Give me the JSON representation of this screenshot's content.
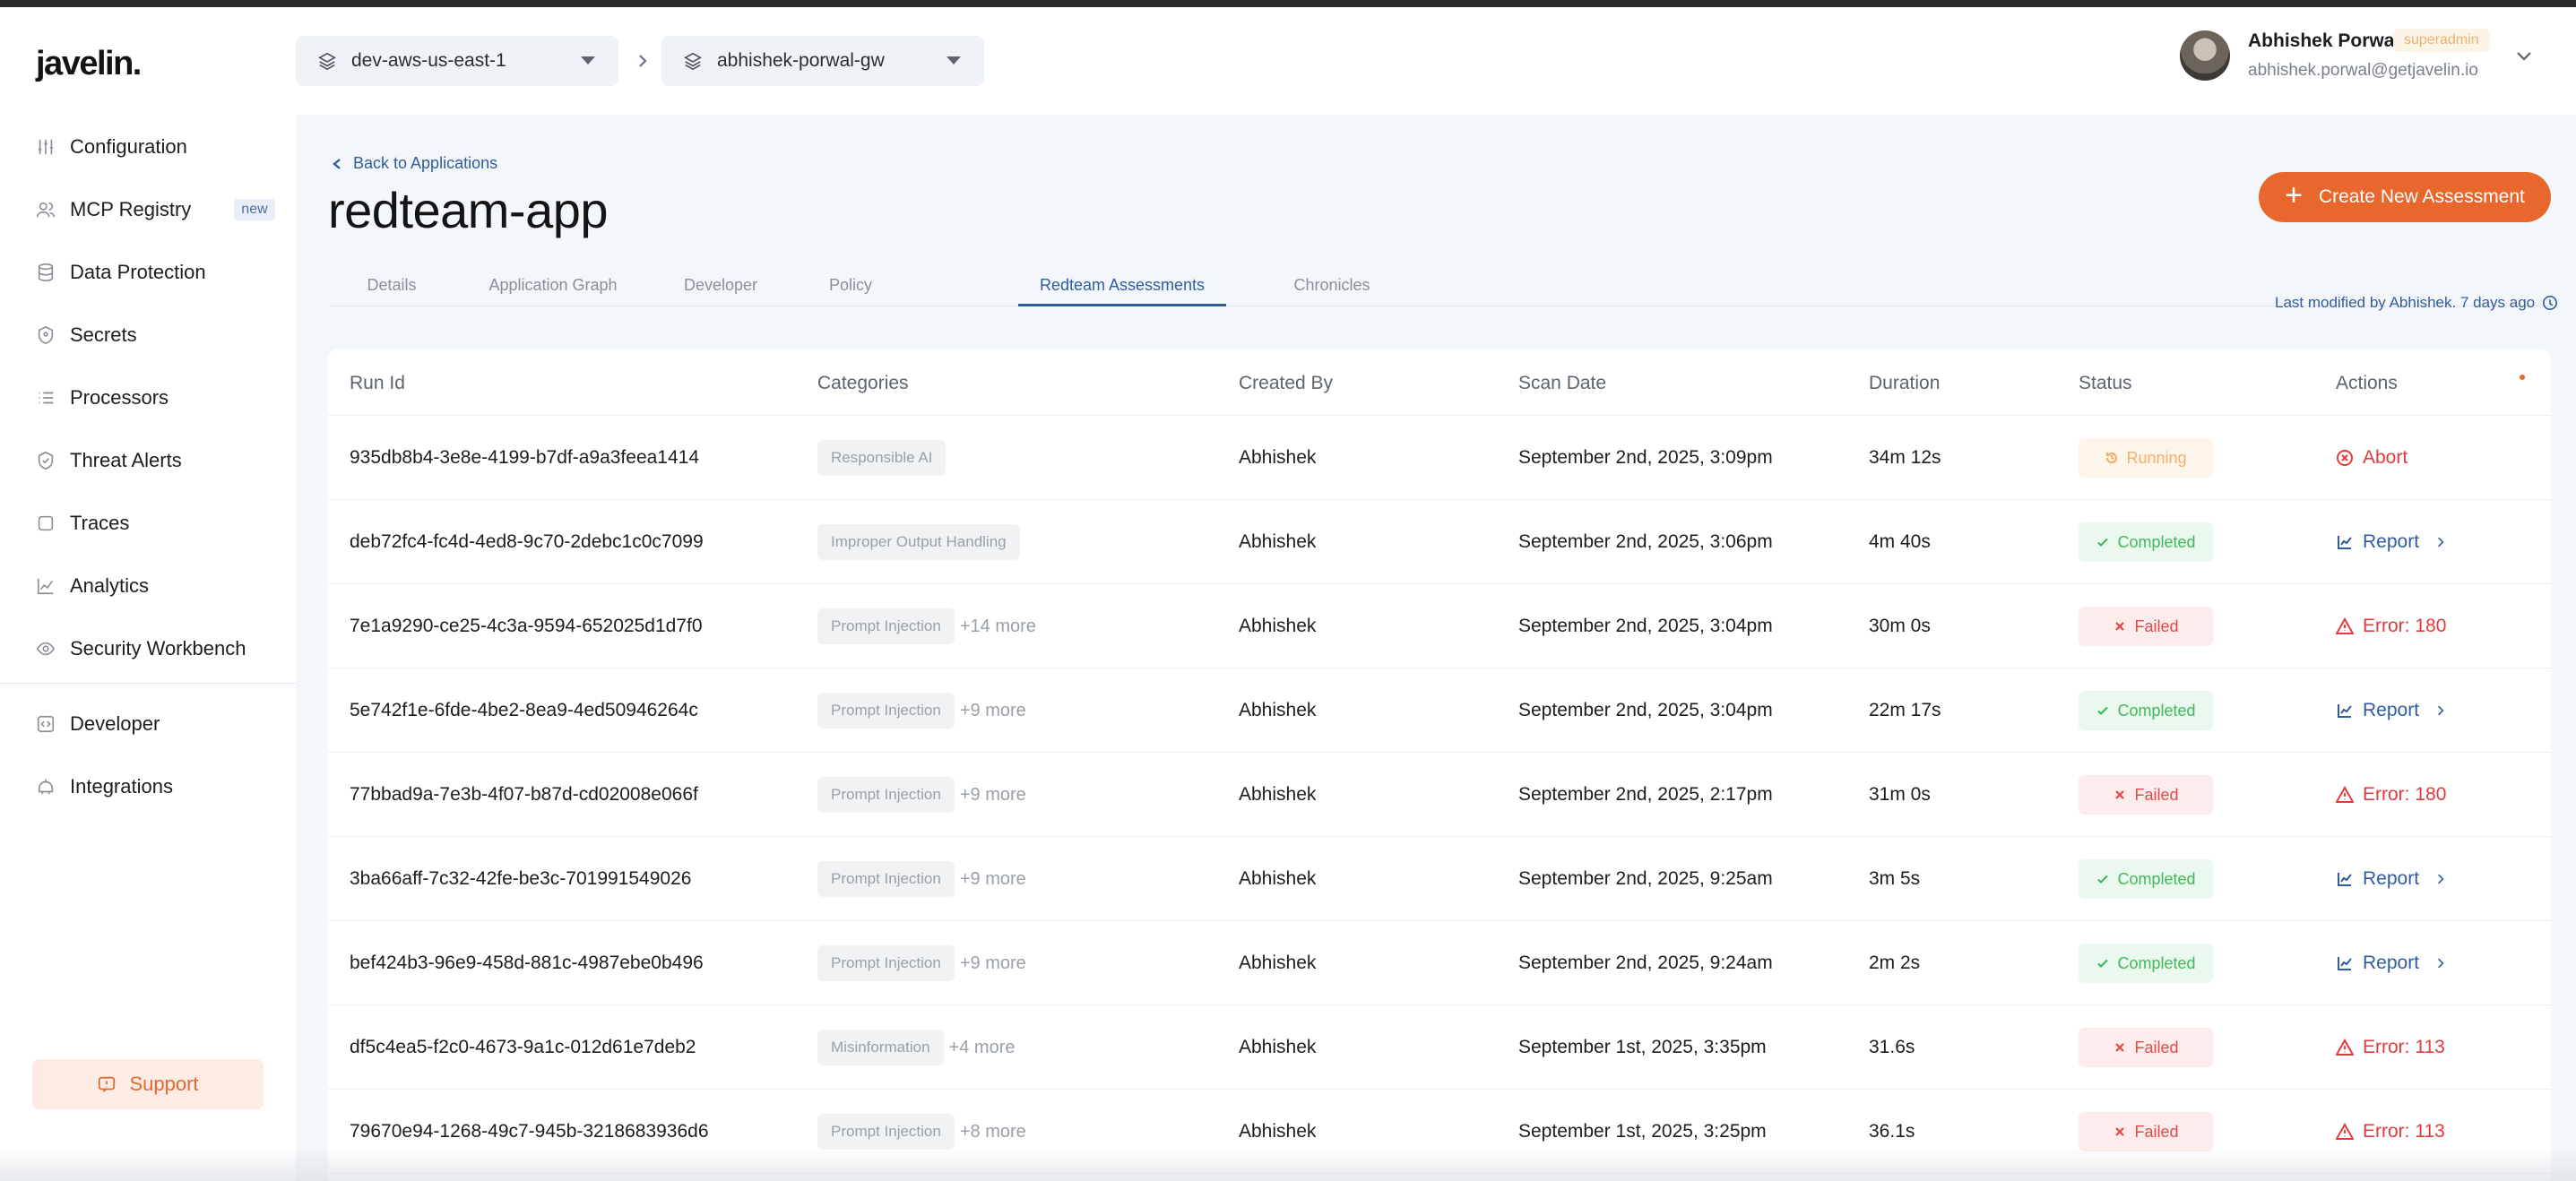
{
  "app": {
    "logo": "javelin."
  },
  "sidebar": {
    "items": [
      {
        "label": "Configuration",
        "icon": "sliders-icon"
      },
      {
        "label": "MCP Registry",
        "icon": "users-icon",
        "badge": "new"
      },
      {
        "label": "Data Protection",
        "icon": "database-icon"
      },
      {
        "label": "Secrets",
        "icon": "shield-icon"
      },
      {
        "label": "Processors",
        "icon": "list-icon"
      },
      {
        "label": "Threat Alerts",
        "icon": "shield-check-icon"
      },
      {
        "label": "Traces",
        "icon": "square-icon"
      },
      {
        "label": "Analytics",
        "icon": "line-chart-icon"
      },
      {
        "label": "Security Workbench",
        "icon": "eye-icon"
      },
      {
        "label": "Developer",
        "icon": "code-icon"
      },
      {
        "label": "Integrations",
        "icon": "plug-icon"
      }
    ],
    "support_label": "Support"
  },
  "header": {
    "environment": "dev-aws-us-east-1",
    "gateway": "abhishek-porwal-gw",
    "user": {
      "name": "Abhishek Porwal",
      "role": "superadmin",
      "email": "abhishek.porwal@getjavelin.io"
    }
  },
  "page": {
    "back_label": "Back to Applications",
    "title": "redteam-app",
    "create_label": "Create New Assessment",
    "tabs": [
      "Details",
      "Application Graph",
      "Developer",
      "Policy",
      "Redteam Assessments",
      "Chronicles"
    ],
    "active_tab": "Redteam Assessments",
    "last_modified": "Last modified by Abhishek. 7 days ago"
  },
  "table": {
    "columns": [
      "Run Id",
      "Categories",
      "Created By",
      "Scan Date",
      "Duration",
      "Status",
      "Actions"
    ],
    "rows": [
      {
        "run_id": "935db8b4-3e8e-4199-b7df-a9a3feea1414",
        "category": "Responsible AI",
        "more": "",
        "created_by": "Abhishek",
        "scan_date": "September 2nd, 2025, 3:09pm",
        "duration": "34m 12s",
        "status": "Running",
        "status_type": "running",
        "action": "Abort",
        "action_type": "abort"
      },
      {
        "run_id": "deb72fc4-fc4d-4ed8-9c70-2debc1c0c7099",
        "category": "Improper Output Handling",
        "more": "",
        "created_by": "Abhishek",
        "scan_date": "September 2nd, 2025, 3:06pm",
        "duration": "4m 40s",
        "status": "Completed",
        "status_type": "completed",
        "action": "Report",
        "action_type": "report"
      },
      {
        "run_id": "7e1a9290-ce25-4c3a-9594-652025d1d7f0",
        "category": "Prompt Injection",
        "more": "+14 more",
        "created_by": "Abhishek",
        "scan_date": "September 2nd, 2025, 3:04pm",
        "duration": "30m 0s",
        "status": "Failed",
        "status_type": "failed",
        "action": "Error: 180",
        "action_type": "error"
      },
      {
        "run_id": "5e742f1e-6fde-4be2-8ea9-4ed50946264c",
        "category": "Prompt Injection",
        "more": "+9 more",
        "created_by": "Abhishek",
        "scan_date": "September 2nd, 2025, 3:04pm",
        "duration": "22m 17s",
        "status": "Completed",
        "status_type": "completed",
        "action": "Report",
        "action_type": "report"
      },
      {
        "run_id": "77bbad9a-7e3b-4f07-b87d-cd02008e066f",
        "category": "Prompt Injection",
        "more": "+9 more",
        "created_by": "Abhishek",
        "scan_date": "September 2nd, 2025, 2:17pm",
        "duration": "31m 0s",
        "status": "Failed",
        "status_type": "failed",
        "action": "Error: 180",
        "action_type": "error"
      },
      {
        "run_id": "3ba66aff-7c32-42fe-be3c-701991549026",
        "category": "Prompt Injection",
        "more": "+9 more",
        "created_by": "Abhishek",
        "scan_date": "September 2nd, 2025, 9:25am",
        "duration": "3m 5s",
        "status": "Completed",
        "status_type": "completed",
        "action": "Report",
        "action_type": "report"
      },
      {
        "run_id": "bef424b3-96e9-458d-881c-4987ebe0b496",
        "category": "Prompt Injection",
        "more": "+9 more",
        "created_by": "Abhishek",
        "scan_date": "September 2nd, 2025, 9:24am",
        "duration": "2m 2s",
        "status": "Completed",
        "status_type": "completed",
        "action": "Report",
        "action_type": "report"
      },
      {
        "run_id": "df5c4ea5-f2c0-4673-9a1c-012d61e7deb2",
        "category": "Misinformation",
        "more": "+4 more",
        "created_by": "Abhishek",
        "scan_date": "September 1st, 2025, 3:35pm",
        "duration": "31.6s",
        "status": "Failed",
        "status_type": "failed",
        "action": "Error: 113",
        "action_type": "error"
      },
      {
        "run_id": "79670e94-1268-49c7-945b-3218683936d6",
        "category": "Prompt Injection",
        "more": "+8 more",
        "created_by": "Abhishek",
        "scan_date": "September 1st, 2025, 3:25pm",
        "duration": "36.1s",
        "status": "Failed",
        "status_type": "failed",
        "action": "Error: 113",
        "action_type": "error"
      }
    ]
  },
  "colors": {
    "accent": "#e8672d",
    "link": "#2f5d9e",
    "success": "#3fb95b",
    "danger": "#e23b3b",
    "warning": "#f0b070"
  }
}
